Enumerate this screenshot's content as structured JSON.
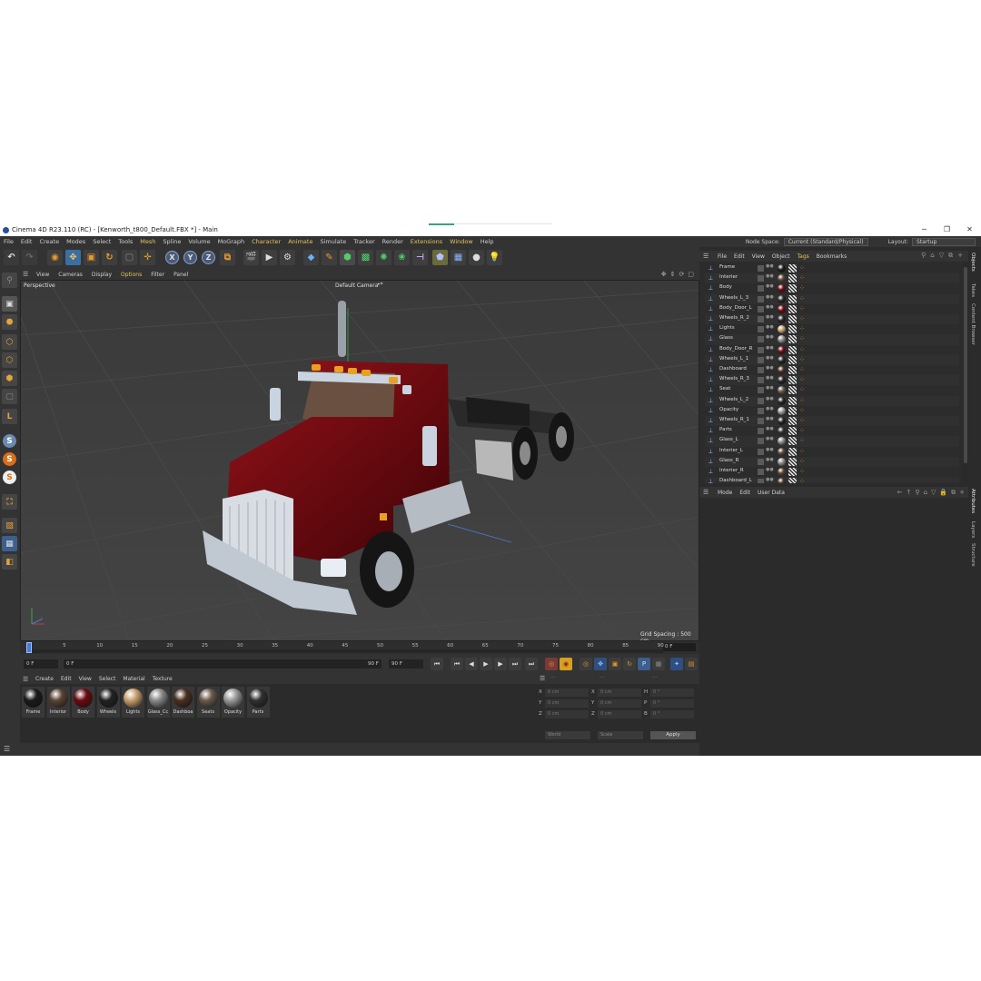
{
  "window": {
    "title": "Cinema 4D R23.110 (RC) - [Kenworth_t800_Default.FBX *] - Main",
    "minimize": "─",
    "maximize": "❐",
    "close": "✕"
  },
  "menu": {
    "items": [
      "File",
      "Edit",
      "Create",
      "Modes",
      "Select",
      "Tools",
      "Mesh",
      "Spline",
      "Volume",
      "MoGraph",
      "Character",
      "Animate",
      "Simulate",
      "Tracker",
      "Render",
      "Extensions",
      "Window",
      "Help"
    ],
    "node_space_label": "Node Space:",
    "node_space_value": "Current (Standard/Physical)",
    "layout_label": "Layout:",
    "layout_value": "Startup"
  },
  "toolbar": {
    "axis_x": "X",
    "axis_y": "Y",
    "axis_z": "Z"
  },
  "left_tools": {
    "s1": "S",
    "s2": "S",
    "s3": "S"
  },
  "viewport": {
    "menu": [
      "View",
      "Cameras",
      "Display",
      "Options",
      "Filter",
      "Panel"
    ],
    "view_name": "Perspective",
    "camera_name": "Default Camera",
    "camera_mark": "•*",
    "grid_spacing": "Grid Spacing : 500 cm"
  },
  "timeline": {
    "ticks": [
      "0",
      "5",
      "10",
      "15",
      "20",
      "25",
      "30",
      "35",
      "40",
      "45",
      "50",
      "55",
      "60",
      "65",
      "70",
      "75",
      "80",
      "85",
      "90"
    ],
    "current_frame": "0 F"
  },
  "transport": {
    "start": "0 F",
    "preview_start": "0 F",
    "preview_end": "90 F",
    "end": "90 F"
  },
  "materials": {
    "menu": [
      "Create",
      "Edit",
      "View",
      "Select",
      "Material",
      "Texture"
    ],
    "items": [
      {
        "name": "Frame",
        "color": "#1a1a1a"
      },
      {
        "name": "Interior",
        "color": "#5a4434"
      },
      {
        "name": "Body",
        "color": "#6b0a10"
      },
      {
        "name": "Wheels",
        "color": "#222222"
      },
      {
        "name": "Lights",
        "color": "#c9a070"
      },
      {
        "name": "Glass_Cc",
        "color": "#8a8a8a"
      },
      {
        "name": "Dashboa",
        "color": "#4a3020"
      },
      {
        "name": "Seats",
        "color": "#6a5a4a"
      },
      {
        "name": "Opacity",
        "color": "#9a9a9a"
      },
      {
        "name": "Parts",
        "color": "#303030"
      }
    ]
  },
  "coords": {
    "x_label": "X",
    "y_label": "Y",
    "z_label": "Z",
    "h_label": "H",
    "p_label": "P",
    "b_label": "B",
    "pos_x": "0 cm",
    "pos_y": "0 cm",
    "pos_z": "0 cm",
    "size_x": "0 cm",
    "size_y": "0 cm",
    "size_z": "0 cm",
    "rot_h": "0 °",
    "rot_p": "0 °",
    "rot_b": "0 °",
    "mode1": "World",
    "mode2": "Scale",
    "apply": "Apply"
  },
  "objects": {
    "menu": [
      "File",
      "Edit",
      "View",
      "Object",
      "Tags",
      "Bookmarks"
    ],
    "rows": [
      {
        "name": "Frame",
        "tag": "#1a1a1a"
      },
      {
        "name": "Interier",
        "tag": "#5a4434"
      },
      {
        "name": "Body",
        "tag": "#6b0a10"
      },
      {
        "name": "Wheels_L_3",
        "tag": "#222222"
      },
      {
        "name": "Body_Door_L",
        "tag": "#6b0a10"
      },
      {
        "name": "Wheels_R_2",
        "tag": "#222222"
      },
      {
        "name": "Lights",
        "tag": "#c9a070"
      },
      {
        "name": "Glass",
        "tag": "#8a8a8a"
      },
      {
        "name": "Body_Door_R",
        "tag": "#6b0a10"
      },
      {
        "name": "Wheels_L_1",
        "tag": "#222222"
      },
      {
        "name": "Dashboard",
        "tag": "#4a3020"
      },
      {
        "name": "Wheels_R_3",
        "tag": "#222222"
      },
      {
        "name": "Seat",
        "tag": "#6a5a4a"
      },
      {
        "name": "Wheels_L_2",
        "tag": "#222222"
      },
      {
        "name": "Opacity",
        "tag": "#9a9a9a"
      },
      {
        "name": "Wheels_R_1",
        "tag": "#222222"
      },
      {
        "name": "Parts",
        "tag": "#303030"
      },
      {
        "name": "Glass_L",
        "tag": "#8a8a8a"
      },
      {
        "name": "Interier_L",
        "tag": "#5a4434"
      },
      {
        "name": "Glass_R",
        "tag": "#8a8a8a"
      },
      {
        "name": "Interier_R",
        "tag": "#5a4434"
      },
      {
        "name": "Dashboard_L",
        "tag": "#4a3020"
      }
    ]
  },
  "attributes": {
    "menu": [
      "Mode",
      "Edit",
      "User Data"
    ]
  },
  "side_tabs": {
    "top": [
      "Objects",
      "Takes",
      "Content Browser"
    ],
    "bottom": [
      "Attributes",
      "Layers",
      "Structure"
    ]
  }
}
